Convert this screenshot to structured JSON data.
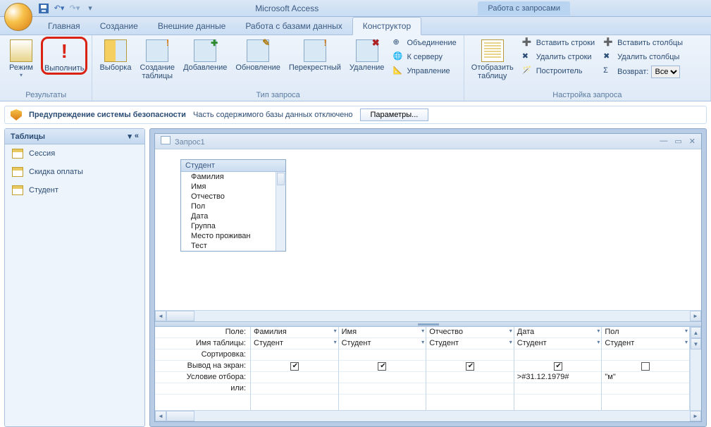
{
  "app_title": "Microsoft Access",
  "context_tab_group": "Работа с запросами",
  "tabs": {
    "home": "Главная",
    "create": "Создание",
    "external": "Внешние данные",
    "dbtools": "Работа с базами данных",
    "design": "Конструктор"
  },
  "ribbon": {
    "results": {
      "label": "Результаты",
      "view": "Режим",
      "run": "Выполнить"
    },
    "querytype": {
      "label": "Тип запроса",
      "select": "Выборка",
      "maketable": "Создание\nтаблицы",
      "append": "Добавление",
      "update": "Обновление",
      "crosstab": "Перекрестный",
      "delete": "Удаление",
      "union": "Объединение",
      "passthrough": "К серверу",
      "datadef": "Управление"
    },
    "setup": {
      "label": "Настройка запроса",
      "showtable": "Отобразить\nтаблицу",
      "insrows": "Вставить строки",
      "delrows": "Удалить строки",
      "builder": "Построитель",
      "inscols": "Вставить столбцы",
      "delcols": "Удалить столбцы",
      "return": "Возврат:",
      "return_val": "Все"
    }
  },
  "security": {
    "title": "Предупреждение системы безопасности",
    "msg": "Часть содержимого базы данных отключено",
    "btn": "Параметры..."
  },
  "nav": {
    "header": "Таблицы",
    "items": [
      "Сессия",
      "Скидка оплаты",
      "Студент"
    ]
  },
  "query_window": {
    "title": "Запрос1",
    "table": {
      "name": "Студент",
      "fields": [
        "Фамилия",
        "Имя",
        "Отчество",
        "Пол",
        "Дата",
        "Группа",
        "Место проживан",
        "Тест"
      ]
    }
  },
  "qbe": {
    "rowlabels": {
      "field": "Поле:",
      "table": "Имя таблицы:",
      "sort": "Сортировка:",
      "show": "Вывод на экран:",
      "criteria": "Условие отбора:",
      "or": "или:"
    },
    "cols": [
      {
        "field": "Фамилия",
        "table": "Студент",
        "show": true,
        "criteria": ""
      },
      {
        "field": "Имя",
        "table": "Студент",
        "show": true,
        "criteria": ""
      },
      {
        "field": "Отчество",
        "table": "Студент",
        "show": true,
        "criteria": ""
      },
      {
        "field": "Дата",
        "table": "Студент",
        "show": true,
        "criteria": ">#31.12.1979#"
      },
      {
        "field": "Пол",
        "table": "Студент",
        "show": false,
        "criteria": "\"м\""
      }
    ]
  }
}
